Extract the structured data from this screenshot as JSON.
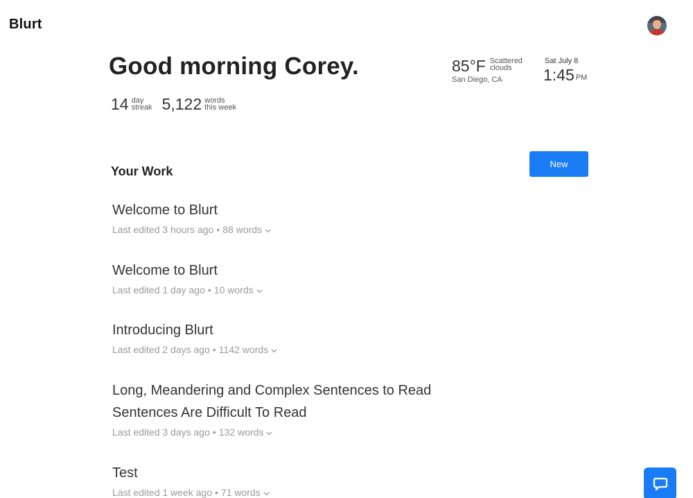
{
  "app": {
    "name": "Blurt"
  },
  "header": {
    "greeting": "Good morning Corey."
  },
  "stats": {
    "streak_value": "14",
    "streak_label_1": "day",
    "streak_label_2": "streak",
    "words_value": "5,122",
    "words_label_1": "words",
    "words_label_2": "this week"
  },
  "weather": {
    "temperature": "85°F",
    "condition_1": "Scattered",
    "condition_2": "clouds",
    "location": "San Diego, CA"
  },
  "datetime": {
    "date": "Sat July 8",
    "time": "1:45",
    "ampm": "PM"
  },
  "work": {
    "title": "Your Work",
    "new_label": "New",
    "documents": [
      {
        "title": "Welcome to Blurt",
        "edited": "Last edited 3 hours ago",
        "words": "88 words"
      },
      {
        "title": "Welcome to Blurt",
        "edited": "Last edited 1 day ago",
        "words": "10 words"
      },
      {
        "title": "Introducing Blurt",
        "edited": "Last edited 2 days ago",
        "words": "1142 words"
      },
      {
        "title": "Long, Meandering and Complex Sentences to Read Sentences Are Difficult To Read",
        "edited": "Last edited 3 days ago",
        "words": "132 words"
      },
      {
        "title": "Test",
        "edited": "Last edited 1 week ago",
        "words": "71 words"
      }
    ],
    "separator": "•"
  },
  "colors": {
    "accent": "#1a7cf5",
    "meta_text": "#9a9a9a"
  },
  "icons": {
    "chevron": "chevron-down-icon",
    "chat": "chat-bubble-icon",
    "avatar": "user-avatar"
  }
}
